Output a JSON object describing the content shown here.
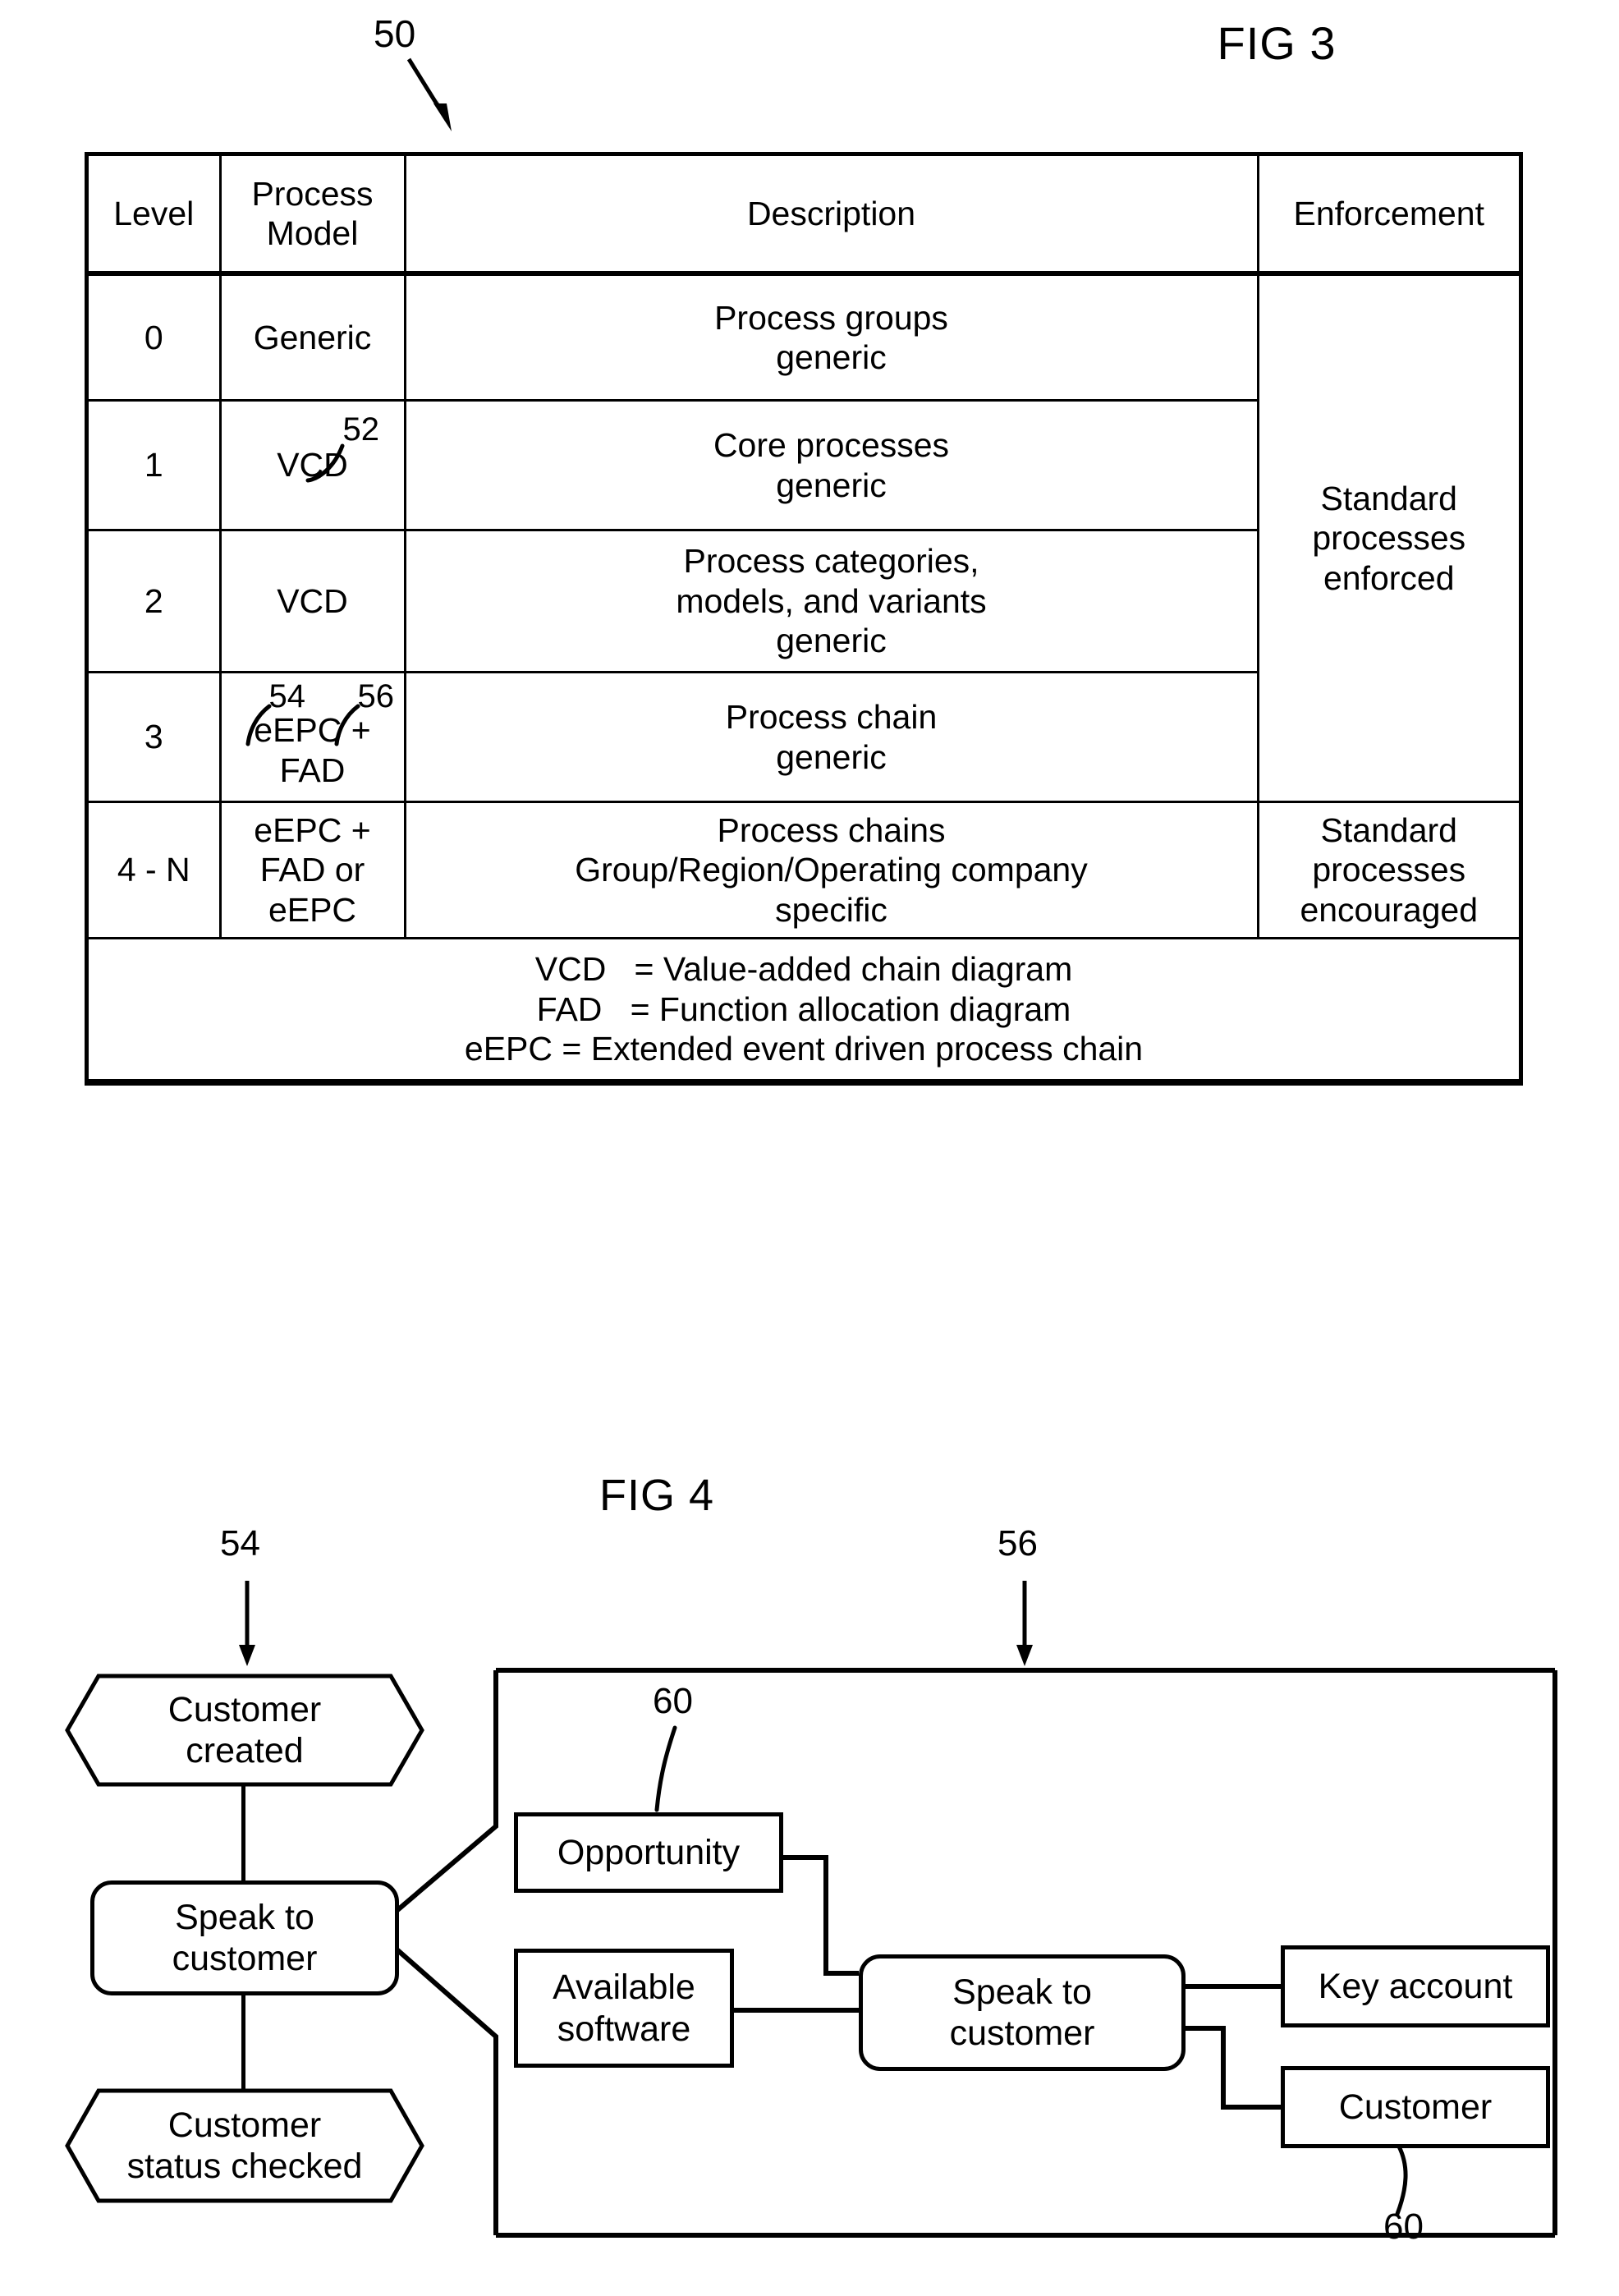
{
  "figures": {
    "fig3": {
      "title": "FIG 3",
      "ref_label": "50",
      "table": {
        "headers": [
          "Level",
          "Process\nModel",
          "Description",
          "Enforcement"
        ],
        "header_level": "Level",
        "header_model_line1": "Process",
        "header_model_line2": "Model",
        "header_description": "Description",
        "header_enforcement": "Enforcement",
        "rows": [
          {
            "level": "0",
            "model": "Generic",
            "model_ref": "",
            "description_line1": "Process groups",
            "description_line2": "generic",
            "description_line3": "",
            "enforcement": ""
          },
          {
            "level": "1",
            "model": "VCD",
            "model_ref": "52",
            "description_line1": "Core processes",
            "description_line2": "generic",
            "description_line3": "",
            "enforcement": ""
          },
          {
            "level": "2",
            "model": "VCD",
            "model_ref": "",
            "description_line1": "Process categories,",
            "description_line2": "models, and variants",
            "description_line3": "generic",
            "enforcement": ""
          },
          {
            "level": "3",
            "model": "eEPC + FAD",
            "model_ref_a": "54",
            "model_ref_b": "56",
            "description_line1": "Process chain",
            "description_line2": "generic",
            "description_line3": "",
            "enforcement": ""
          },
          {
            "level": "4 - N",
            "model_line1": "eEPC +",
            "model_line2": "FAD or eEPC",
            "description_line1": "Process chains",
            "description_line2": "Group/Region/Operating company",
            "description_line3": "specific",
            "enforcement_line1": "Standard",
            "enforcement_line2": "processes",
            "enforcement_line3": "encouraged"
          }
        ],
        "enforcement_merged_line1": "Standard",
        "enforcement_merged_line2": "processes",
        "enforcement_merged_line3": "enforced",
        "legend": [
          "VCD   = Value-added chain diagram",
          "FAD   = Function allocation diagram",
          "eEPC = Extended event driven process chain"
        ]
      }
    },
    "fig4": {
      "title": "FIG 4",
      "ref_eepc": "54",
      "ref_fad": "56",
      "eepc": {
        "event_start_line1": "Customer",
        "event_start_line2": "created",
        "function_line1": "Speak to",
        "function_line2": "customer",
        "event_end_line1": "Customer",
        "event_end_line2": "status checked"
      },
      "fad": {
        "ref_top": "60",
        "ref_bottom": "60",
        "input_opportunity": "Opportunity",
        "input_software_line1": "Available",
        "input_software_line2": "software",
        "function_line1": "Speak to",
        "function_line2": "customer",
        "output_key_account": "Key account",
        "output_customer": "Customer"
      }
    }
  }
}
